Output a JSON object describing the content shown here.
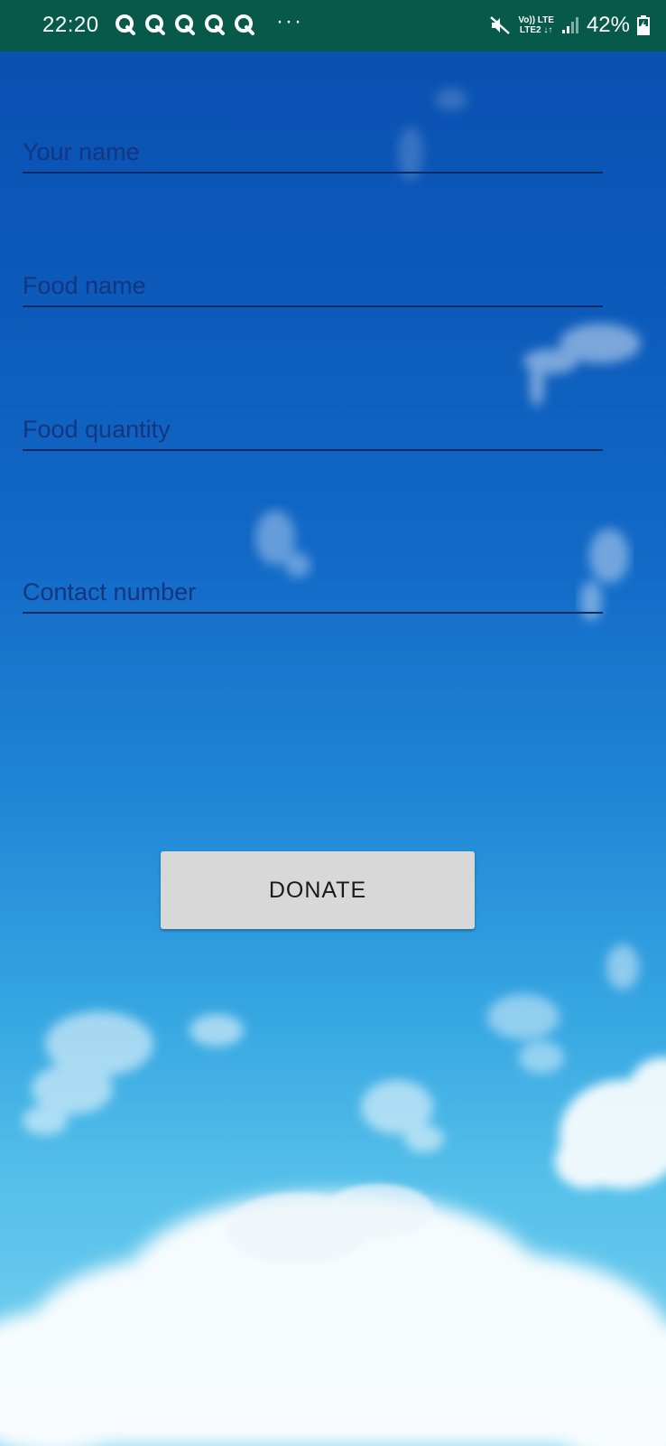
{
  "status_bar": {
    "time": "22:20",
    "notification_icons": [
      "q-app-icon",
      "q-app-icon",
      "q-app-icon",
      "q-app-icon",
      "q-app-icon"
    ],
    "more": "···",
    "network_top": "Vo)) LTE",
    "network_bottom": "LTE2 ↓↑",
    "battery": "42%",
    "colors": {
      "background": "#075a49",
      "foreground": "#ffffff"
    }
  },
  "form": {
    "your_name_placeholder": "Your name",
    "food_name_placeholder": "Food name",
    "food_quantity_placeholder": "Food quantity",
    "contact_number_placeholder": "Contact number",
    "donate_label": "DONATE"
  },
  "colors": {
    "sky_top": "#0a4fb0",
    "sky_bottom": "#7fd4f0",
    "button_bg": "#d8d8d8",
    "field_text": "#14357f"
  }
}
